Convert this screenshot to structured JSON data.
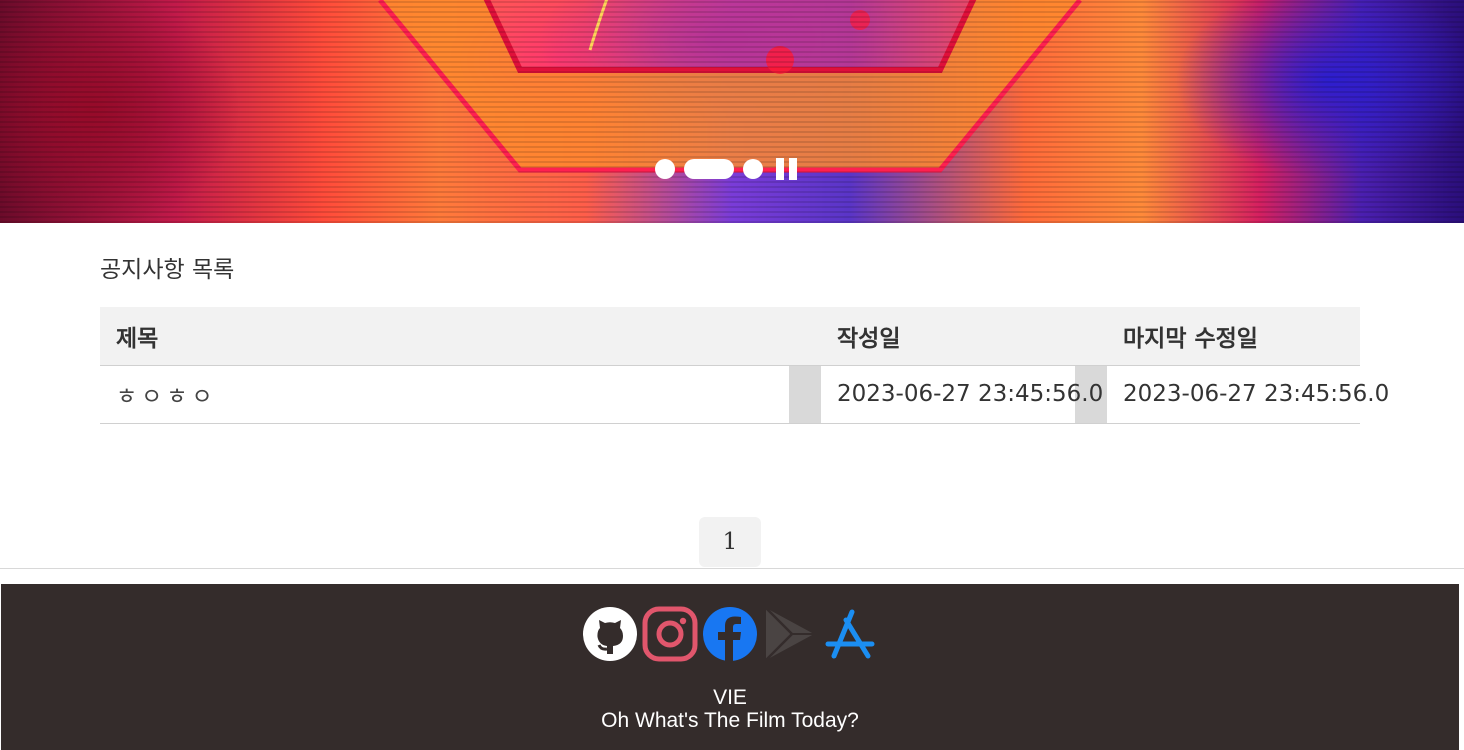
{
  "hero": {
    "slides": 3,
    "active_slide": 2,
    "pause_icon": "pause-icon"
  },
  "page": {
    "heading": "공지사항 목록"
  },
  "table": {
    "headers": {
      "title": "제목",
      "created": "작성일",
      "modified": "마지막 수정일"
    },
    "rows": [
      {
        "title": "ㅎㅇㅎㅇ",
        "created": "2023-06-27 23:45:56.0",
        "modified": "2023-06-27 23:45:56.0"
      }
    ]
  },
  "pagination": {
    "current": "1"
  },
  "footer": {
    "icons": [
      "github-icon",
      "instagram-icon",
      "facebook-icon",
      "google-play-icon",
      "app-store-icon"
    ],
    "brand": "VIE",
    "tagline": "Oh What's The Film Today?",
    "colors": {
      "background": "#342c2b",
      "instagram": "#e1566c",
      "facebook": "#1877f2",
      "app_store": "#1b8ef2"
    }
  }
}
